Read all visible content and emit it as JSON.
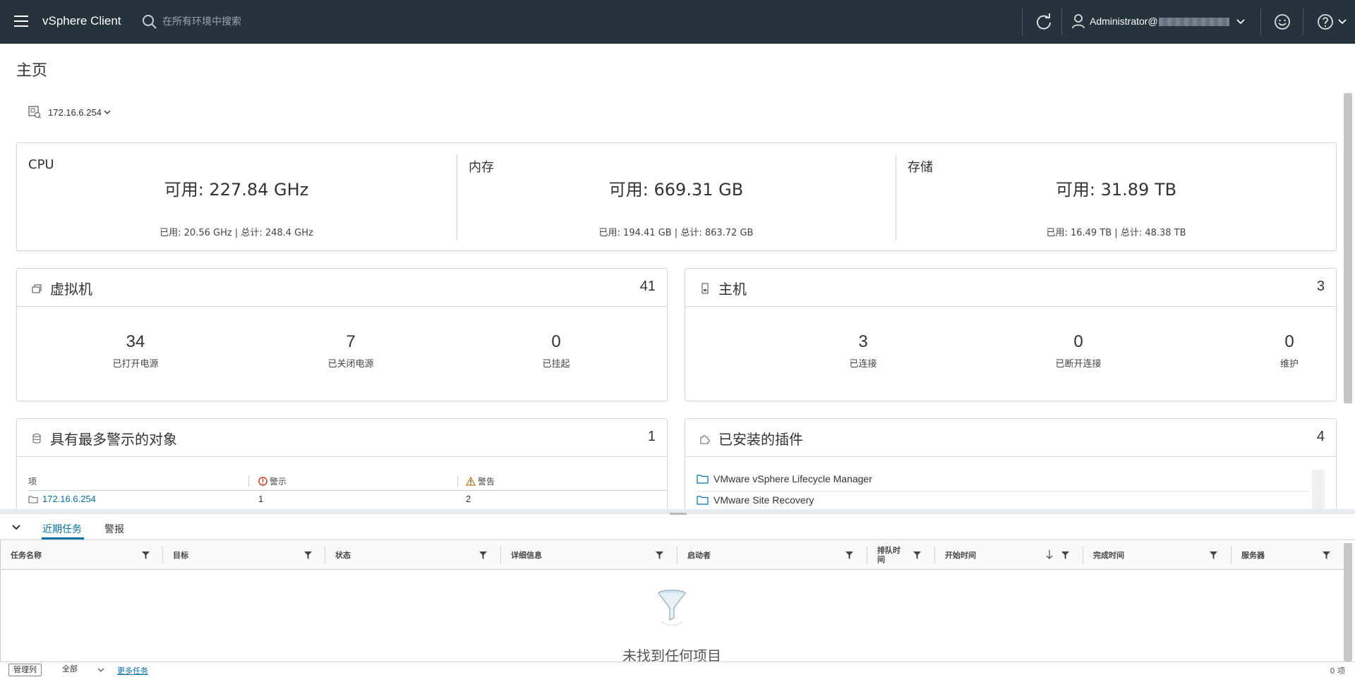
{
  "header": {
    "app_title": "vSphere Client",
    "search_placeholder": "在所有环境中搜索",
    "user_name": "Administrator@"
  },
  "page": {
    "title": "主页",
    "host_selector": "172.16.6.254"
  },
  "resources": [
    {
      "label": "CPU",
      "available": "可用: 227.84 GHz",
      "detail": "已用: 20.56 GHz | 总计: 248.4 GHz"
    },
    {
      "label": "内存",
      "available": "可用: 669.31 GB",
      "detail": "已用: 194.41 GB | 总计: 863.72 GB"
    },
    {
      "label": "存储",
      "available": "可用: 31.89 TB",
      "detail": "已用: 16.49 TB | 总计: 48.38 TB"
    }
  ],
  "vms": {
    "title": "虚拟机",
    "count": "41",
    "stats": [
      {
        "value": "34",
        "label": "已打开电源"
      },
      {
        "value": "7",
        "label": "已关闭电源"
      },
      {
        "value": "0",
        "label": "已挂起"
      }
    ]
  },
  "hosts": {
    "title": "主机",
    "count": "3",
    "stats": [
      {
        "value": "3",
        "label": "已连接"
      },
      {
        "value": "0",
        "label": "已断开连接"
      },
      {
        "value": "0",
        "label": "维护"
      }
    ]
  },
  "alerts": {
    "title": "具有最多警示的对象",
    "count": "1",
    "columns": [
      "项",
      "警示",
      "警告"
    ],
    "rows": [
      {
        "item": "172.16.6.254",
        "alarms": "1",
        "warnings": "2"
      }
    ]
  },
  "plugins": {
    "title": "已安装的插件",
    "count": "4",
    "items": [
      "VMware vSphere Lifecycle Manager",
      "VMware Site Recovery"
    ]
  },
  "bottom_panel": {
    "tabs": [
      "近期任务",
      "警报"
    ],
    "columns": [
      "任务名称",
      "目标",
      "状态",
      "详细信息",
      "启动者",
      "排队时间",
      "开始时间",
      "完成时间",
      "服务器"
    ],
    "empty_message": "未找到任何项目",
    "footer": {
      "manage_columns": "管理列",
      "filter_select": "全部",
      "more_tasks": "更多任务",
      "item_count": "0 项"
    }
  },
  "colors": {
    "header_bg": "#25333d",
    "link": "#0072a3",
    "alarm_red": "#c92100",
    "warning_orange": "#c27b00"
  }
}
